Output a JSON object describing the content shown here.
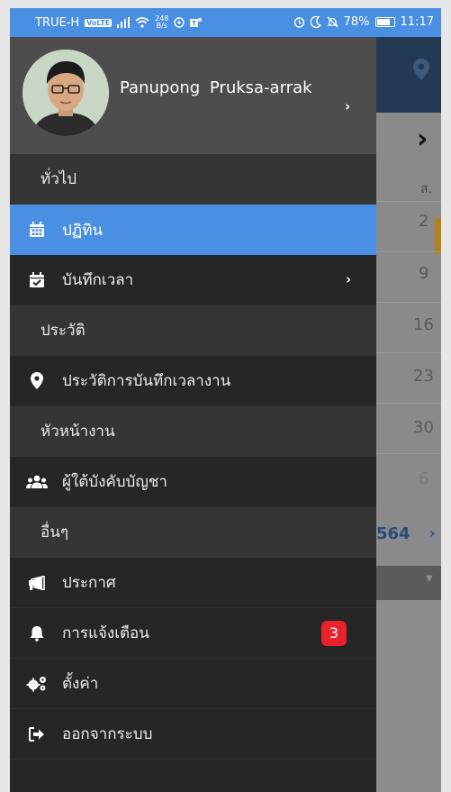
{
  "status_bar": {
    "carrier": "TRUE-H",
    "network_badge": "VoLTE",
    "speed_value": "248",
    "speed_unit": "B/s",
    "battery_percent": "78%",
    "battery_level": 0.78,
    "time": "11:17",
    "icons": [
      "signal-icon",
      "wifi-icon",
      "location-icon",
      "teams-icon",
      "alarm-icon",
      "moon-icon",
      "mute-icon",
      "battery-icon"
    ]
  },
  "profile": {
    "name": "Panupong  Pruksa-arrak"
  },
  "menu": {
    "section_general": "ทั่วไป",
    "calendar": "ปฏิทิน",
    "record_time": "บันทึกเวลา",
    "section_history": "ประวัติ",
    "time_history": "ประวัติการบันทึกเวลางาน",
    "section_supervisor": "หัวหน้างาน",
    "subordinates": "ผู้ใต้บังคับบัญชา",
    "section_other": "อื่นๆ",
    "announcements": "ประกาศ",
    "notifications": "การแจ้งเตือน",
    "notifications_count": "3",
    "settings": "ตั้งค่า",
    "logout": "ออกจากระบบ"
  },
  "background_calendar": {
    "day_header": "ส.",
    "dates": [
      "2",
      "9",
      "16",
      "23",
      "30",
      "6"
    ],
    "year_suffix": "564"
  },
  "colors": {
    "status_bar": "#4a90e2",
    "active_item": "#4a90e2",
    "drawer_bg": "#262626",
    "section_bg": "#353535",
    "profile_bg": "#4d4d4d",
    "badge": "#e8212a"
  }
}
